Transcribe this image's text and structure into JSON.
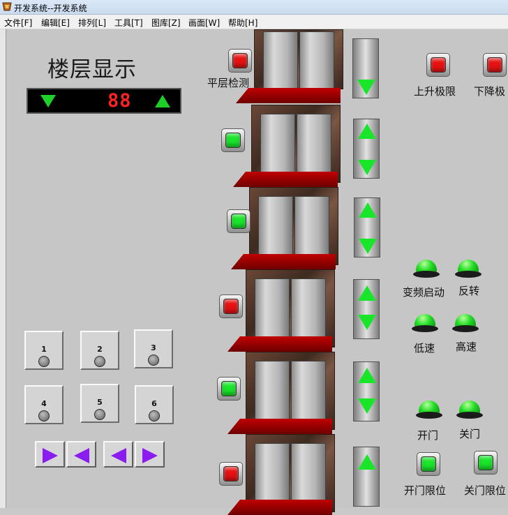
{
  "window": {
    "title": "开发系统--开发系统"
  },
  "menu": [
    {
      "label": "文件[F]"
    },
    {
      "label": "编辑[E]"
    },
    {
      "label": "排列[L]"
    },
    {
      "label": "工具[T]"
    },
    {
      "label": "图库[Z]"
    },
    {
      "label": "画面[W]"
    },
    {
      "label": "帮助[H]"
    }
  ],
  "display": {
    "heading": "楼层显示",
    "digits": "88"
  },
  "indicators": {
    "level_detect": "平层检测",
    "up_limit": "上升极限",
    "down_limit": "下降极"
  },
  "status_lamps": [
    {
      "label": "变频启动"
    },
    {
      "label": "反转"
    },
    {
      "label": "低速"
    },
    {
      "label": "高速"
    },
    {
      "label": "开门"
    },
    {
      "label": "关门"
    }
  ],
  "door_limits": {
    "open": "开门限位",
    "close": "关门限位"
  },
  "car_buttons": [
    "1",
    "2",
    "3",
    "4",
    "5",
    "6"
  ],
  "colors": {
    "led_red": "#e81111",
    "led_green": "#19e62a",
    "arrow_green": "#1ecf2a",
    "door_arrow": "#8a1cf0",
    "sill": "#c00000"
  }
}
